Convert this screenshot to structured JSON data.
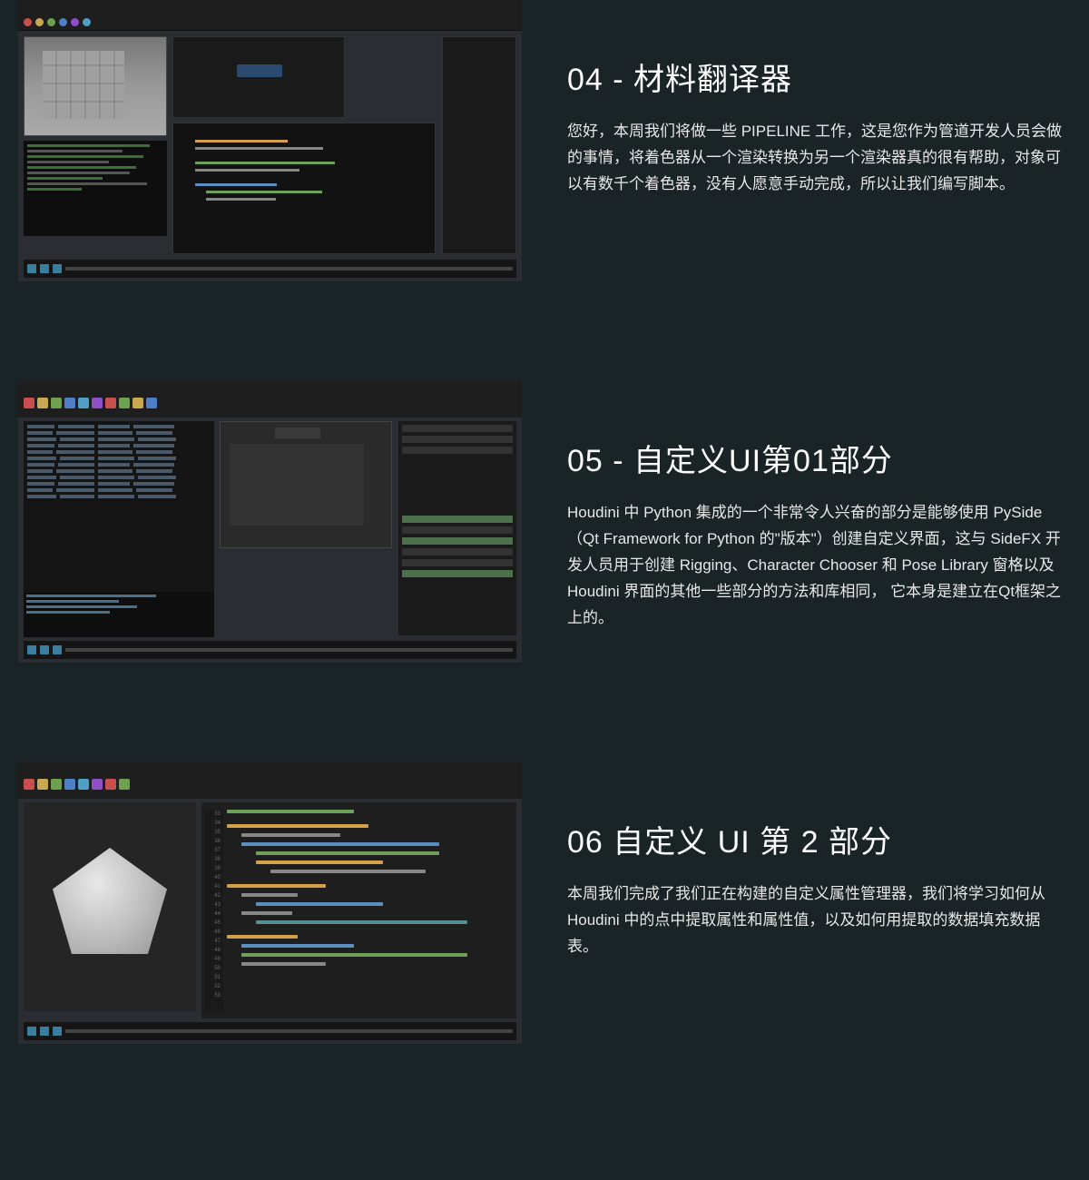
{
  "items": [
    {
      "title": "04 - 材料翻译器",
      "body": "您好，本周我们将做一些 PIPELINE 工作，这是您作为管道开发人员会做的事情，将着色器从一个渲染转换为另一个渲染器真的很有帮助，对象可以有数千个着色器，没有人愿意手动完成，所以让我们编写脚本。"
    },
    {
      "title": "05 - 自定义UI第01部分",
      "body": "Houdini 中 Python 集成的一个非常令人兴奋的部分是能够使用 PySide（Qt Framework for Python 的\"版本\"）创建自定义界面，这与 SideFX 开发人员用于创建 Rigging、Character Chooser 和 Pose Library 窗格以及 Houdini 界面的其他一些部分的方法和库相同， 它本身是建立在Qt框架之上的。"
    },
    {
      "title": "06 自定义 UI 第 2 部分",
      "body": "本周我们完成了我们正在构建的自定义属性管理器，我们将学习如何从 Houdini 中的点中提取属性和属性值，以及如何用提取的数据填充数据表。"
    }
  ]
}
